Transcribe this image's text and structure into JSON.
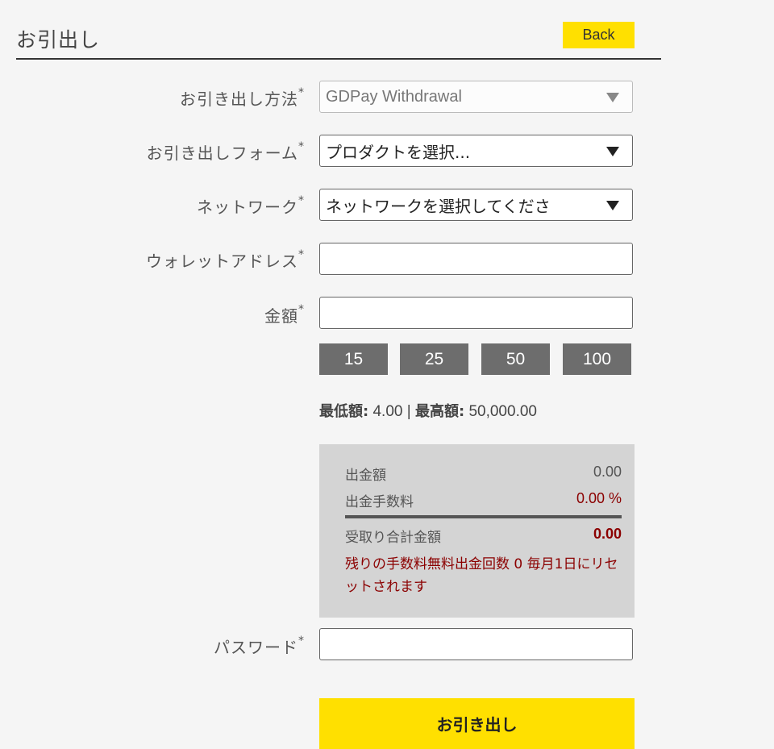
{
  "header": {
    "title": "お引出し",
    "back_label": "Back"
  },
  "form": {
    "method": {
      "label": "お引き出し方法",
      "value": "GDPay Withdrawal"
    },
    "form_type": {
      "label": "お引き出しフォーム",
      "value": "プロダクトを選択..."
    },
    "network": {
      "label": "ネットワーク",
      "value": "ネットワークを選択してくださ"
    },
    "wallet": {
      "label": "ウォレットアドレス",
      "value": ""
    },
    "amount": {
      "label": "金額",
      "value": ""
    },
    "password": {
      "label": "パスワード",
      "value": ""
    },
    "required_mark": "*"
  },
  "quick_amounts": [
    "15",
    "25",
    "50",
    "100"
  ],
  "limits": {
    "min_label": "最低額:",
    "min_value": "4.00",
    "separator": "|",
    "max_label": "最高額:",
    "max_value": "50,000.00"
  },
  "summary": {
    "withdraw_label": "出金額",
    "withdraw_value": "0.00",
    "fee_label": "出金手数料",
    "fee_value": "0.00 %",
    "total_label": "受取り合計金額",
    "total_value": "0.00",
    "note": "残りの手数料無料出金回数 0 毎月1日にリセットされます"
  },
  "submit_label": "お引き出し",
  "colors": {
    "accent": "#ffe000",
    "quick_button": "#6d6d6d",
    "alert": "#8b0000",
    "panel": "#d4d4d4"
  }
}
